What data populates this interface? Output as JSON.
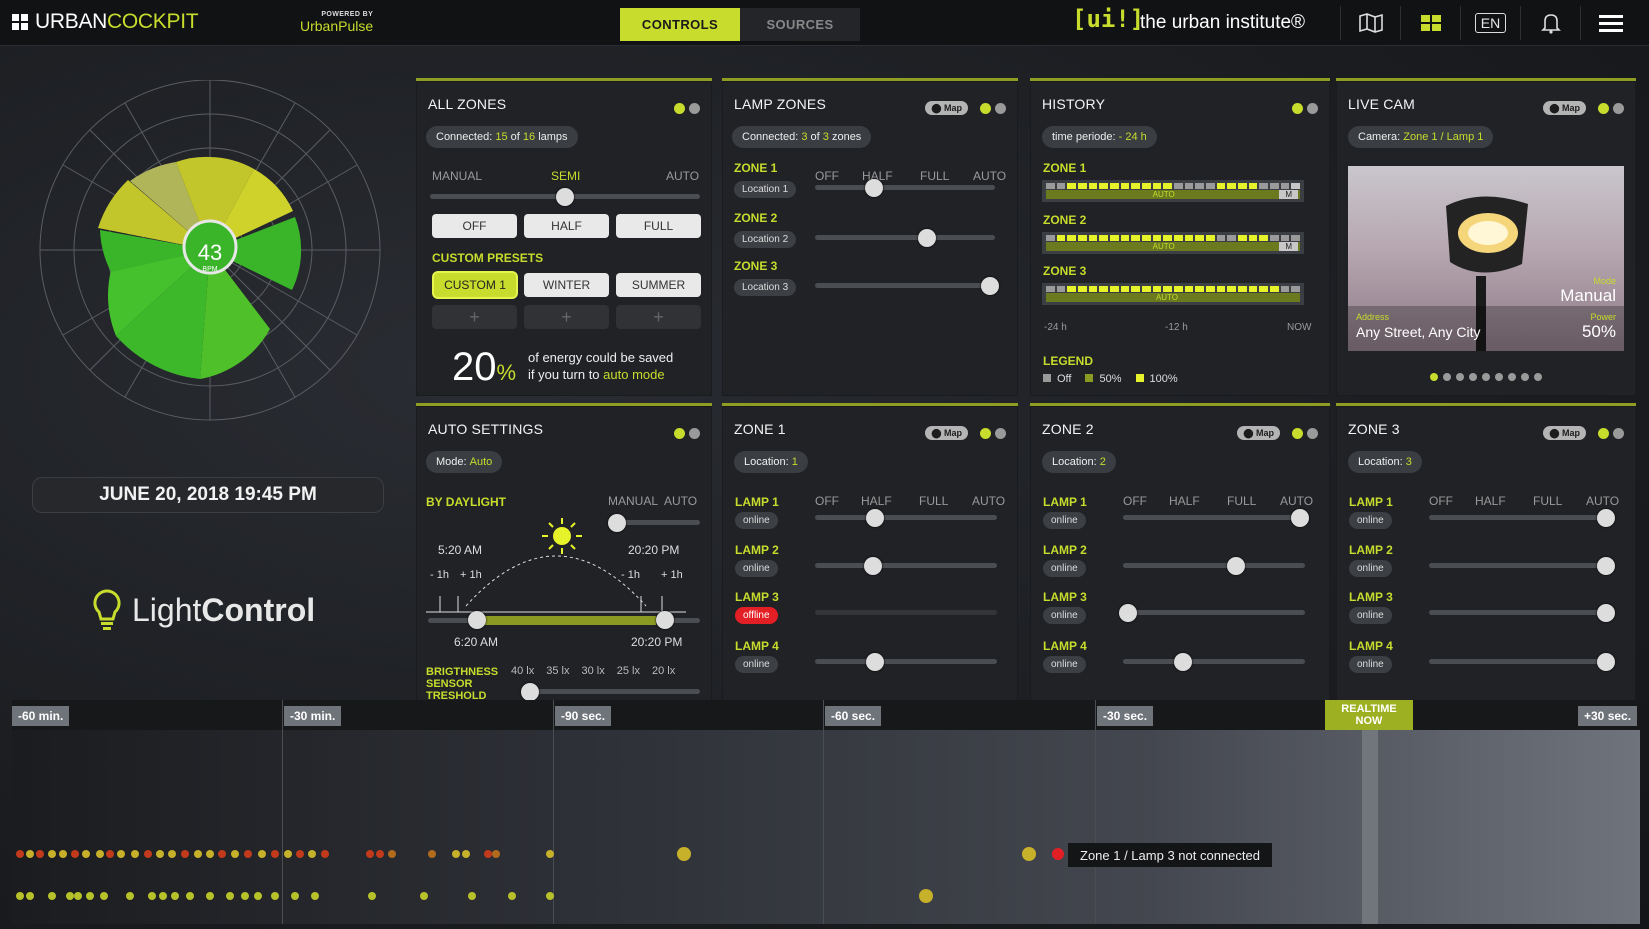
{
  "header": {
    "brand_urban": "URBAN",
    "brand_cockpit": "COCKPIT",
    "powered_by": "POWERED BY",
    "powered_name": "UrbanPulse",
    "tabs": [
      "CONTROLS",
      "SOURCES"
    ],
    "ui_logo": "[ui!]",
    "ui_name": "the urban institute®",
    "lang": "EN",
    "icons": [
      "map-icon",
      "grid-icon",
      "language-icon",
      "bell-icon",
      "menu-icon"
    ]
  },
  "radar": {
    "value": "43",
    "unit": "BPM"
  },
  "date": "JUNE 20, 2018 19:45 PM",
  "app": {
    "light": "Light",
    "control": "Control"
  },
  "all_zones": {
    "title": "ALL ZONES",
    "connected_prefix": "Connected:",
    "connected_count": "15",
    "connected_of": "of",
    "connected_total": "16",
    "connected_suffix": "lamps",
    "modes": [
      "MANUAL",
      "SEMI",
      "AUTO"
    ],
    "mode_level": 0.5,
    "buttons": [
      "OFF",
      "HALF",
      "FULL"
    ],
    "presets_label": "CUSTOM PRESETS",
    "presets": [
      "CUSTOM 1",
      "WINTER",
      "SUMMER"
    ],
    "plus": "+",
    "percent": "20",
    "percent_sign": "%",
    "energy_line1": "of energy could be saved",
    "energy_line2_prefix": "if you turn to",
    "energy_line2_link": "auto mode"
  },
  "lamp_zones": {
    "title": "LAMP ZONES",
    "map": "Map",
    "connected_prefix": "Connected:",
    "connected_count": "3",
    "connected_of": "of",
    "connected_total": "3",
    "connected_suffix": "zones",
    "levels": [
      "OFF",
      "HALF",
      "FULL",
      "AUTO"
    ],
    "zones": [
      {
        "name": "ZONE 1",
        "loc": "Location 1",
        "level": 0.33
      },
      {
        "name": "ZONE 2",
        "loc": "Location 2",
        "level": 0.62
      },
      {
        "name": "ZONE 3",
        "loc": "Location 3",
        "level": 0.97
      }
    ]
  },
  "history": {
    "title": "HISTORY",
    "period_prefix": "time periode:",
    "period_value": "- 24 h",
    "zones": [
      {
        "name": "ZONE 1",
        "mode": "AUTO",
        "flag": "M"
      },
      {
        "name": "ZONE 2",
        "mode": "AUTO",
        "flag": "M"
      },
      {
        "name": "ZONE 3",
        "mode": "AUTO",
        "flag": ""
      }
    ],
    "axis": [
      "-24 h",
      "-12 h",
      "NOW"
    ],
    "legend_label": "LEGEND",
    "legend": [
      "Off",
      "50%",
      "100%"
    ]
  },
  "live_cam": {
    "title": "LIVE CAM",
    "map": "Map",
    "camera_prefix": "Camera:",
    "camera_value": "Zone 1 / Lamp  1",
    "mode_label": "Mode",
    "mode_value": "Manual",
    "address_label": "Address",
    "address_value": "Any Street, Any City",
    "power_label": "Power",
    "power_value": "50%"
  },
  "auto_settings": {
    "title": "AUTO SETTINGS",
    "mode_prefix": "Mode:",
    "mode_value": "Auto",
    "daylight_label": "BY DAYLIGHT",
    "manual": "MANUAL",
    "auto": "AUTO",
    "sunrise": "5:20 AM",
    "sunset": "20:20 PM",
    "minus1h_a": "- 1h",
    "plus1h_a": "+ 1h",
    "minus1h_b": "- 1h",
    "plus1h_b": "+ 1h",
    "range_start": "6:20 AM",
    "range_end": "20:20 PM",
    "brightness_label1": "BRIGTHNESS",
    "brightness_label2": "SENSOR",
    "brightness_label3": "TRESHOLD",
    "lux": [
      "40 lx",
      "35 lx",
      "30 lx",
      "25 lx",
      "20 lx"
    ]
  },
  "zone_cards": [
    {
      "title": "ZONE 1",
      "map": "Map",
      "loc_prefix": "Location:",
      "loc": "1",
      "levels": [
        "OFF",
        "HALF",
        "FULL",
        "AUTO"
      ],
      "lamps": [
        {
          "name": "LAMP 1",
          "status": "online",
          "level": 0.33
        },
        {
          "name": "LAMP 2",
          "status": "online",
          "level": 0.32
        },
        {
          "name": "LAMP 3",
          "status": "offline",
          "level": null
        },
        {
          "name": "LAMP 4",
          "status": "online",
          "level": 0.33
        }
      ]
    },
    {
      "title": "ZONE 2",
      "map": "Map",
      "loc_prefix": "Location:",
      "loc": "2",
      "levels": [
        "OFF",
        "HALF",
        "FULL",
        "AUTO"
      ],
      "lamps": [
        {
          "name": "LAMP 1",
          "status": "online",
          "level": 0.97
        },
        {
          "name": "LAMP 2",
          "status": "online",
          "level": 0.62
        },
        {
          "name": "LAMP 3",
          "status": "online",
          "level": 0.03
        },
        {
          "name": "LAMP 4",
          "status": "online",
          "level": 0.33
        }
      ]
    },
    {
      "title": "ZONE 3",
      "map": "Map",
      "loc_prefix": "Location:",
      "loc": "3",
      "levels": [
        "OFF",
        "HALF",
        "FULL",
        "AUTO"
      ],
      "lamps": [
        {
          "name": "LAMP 1",
          "status": "online",
          "level": 0.97
        },
        {
          "name": "LAMP 2",
          "status": "online",
          "level": 0.97
        },
        {
          "name": "LAMP 3",
          "status": "online",
          "level": 0.97
        },
        {
          "name": "LAMP 4",
          "status": "online",
          "level": 0.97
        }
      ]
    }
  ],
  "timeline": {
    "marks": [
      "-60 min.",
      "-30 min.",
      "-90 sec.",
      "-60 sec.",
      "-30 sec.",
      "+30 sec."
    ],
    "now_line1": "REALTIME",
    "now_line2": "NOW",
    "tooltip": "Zone 1 / Lamp 3 not connected"
  },
  "colors": {
    "accent": "#c7dc2c",
    "offline": "#e21f25",
    "green": "#3ab52a"
  }
}
